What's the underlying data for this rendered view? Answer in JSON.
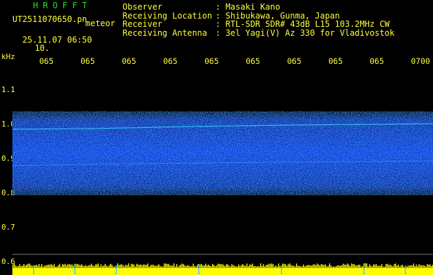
{
  "header": {
    "app_title": "HROFFT",
    "filename": "UT2511070650.pn",
    "type_label": "meteor",
    "timestamp": "25.11.07 06:50",
    "tick_count": "10."
  },
  "meta": [
    {
      "key": "Observer",
      "value": ": Masaki Kano"
    },
    {
      "key": "Receiving Location",
      "value": ": Shibukawa, Gunma, Japan"
    },
    {
      "key": "Receiver",
      "value": ": RTL-SDR SDR# 43dB L15 103.2MHz CW"
    },
    {
      "key": "Receiving Antenna",
      "value": ": 3el Yagi(V) Az 330 for Vladivostok"
    }
  ],
  "axis": {
    "unit": "kHz",
    "x_ticks": [
      "065",
      "065",
      "065",
      "065",
      "065",
      "065",
      "065",
      "065",
      "065",
      "0700"
    ],
    "y_ticks": [
      "1.1",
      "1.0",
      "0.9",
      "0.8",
      "0.7",
      "0.6"
    ]
  },
  "colors": {
    "text": "#ffff3a",
    "title": "#28e028",
    "band_core": "#0a2bd8",
    "band_highlight": "#3fd1ff",
    "baseline": "#ffff00"
  }
}
